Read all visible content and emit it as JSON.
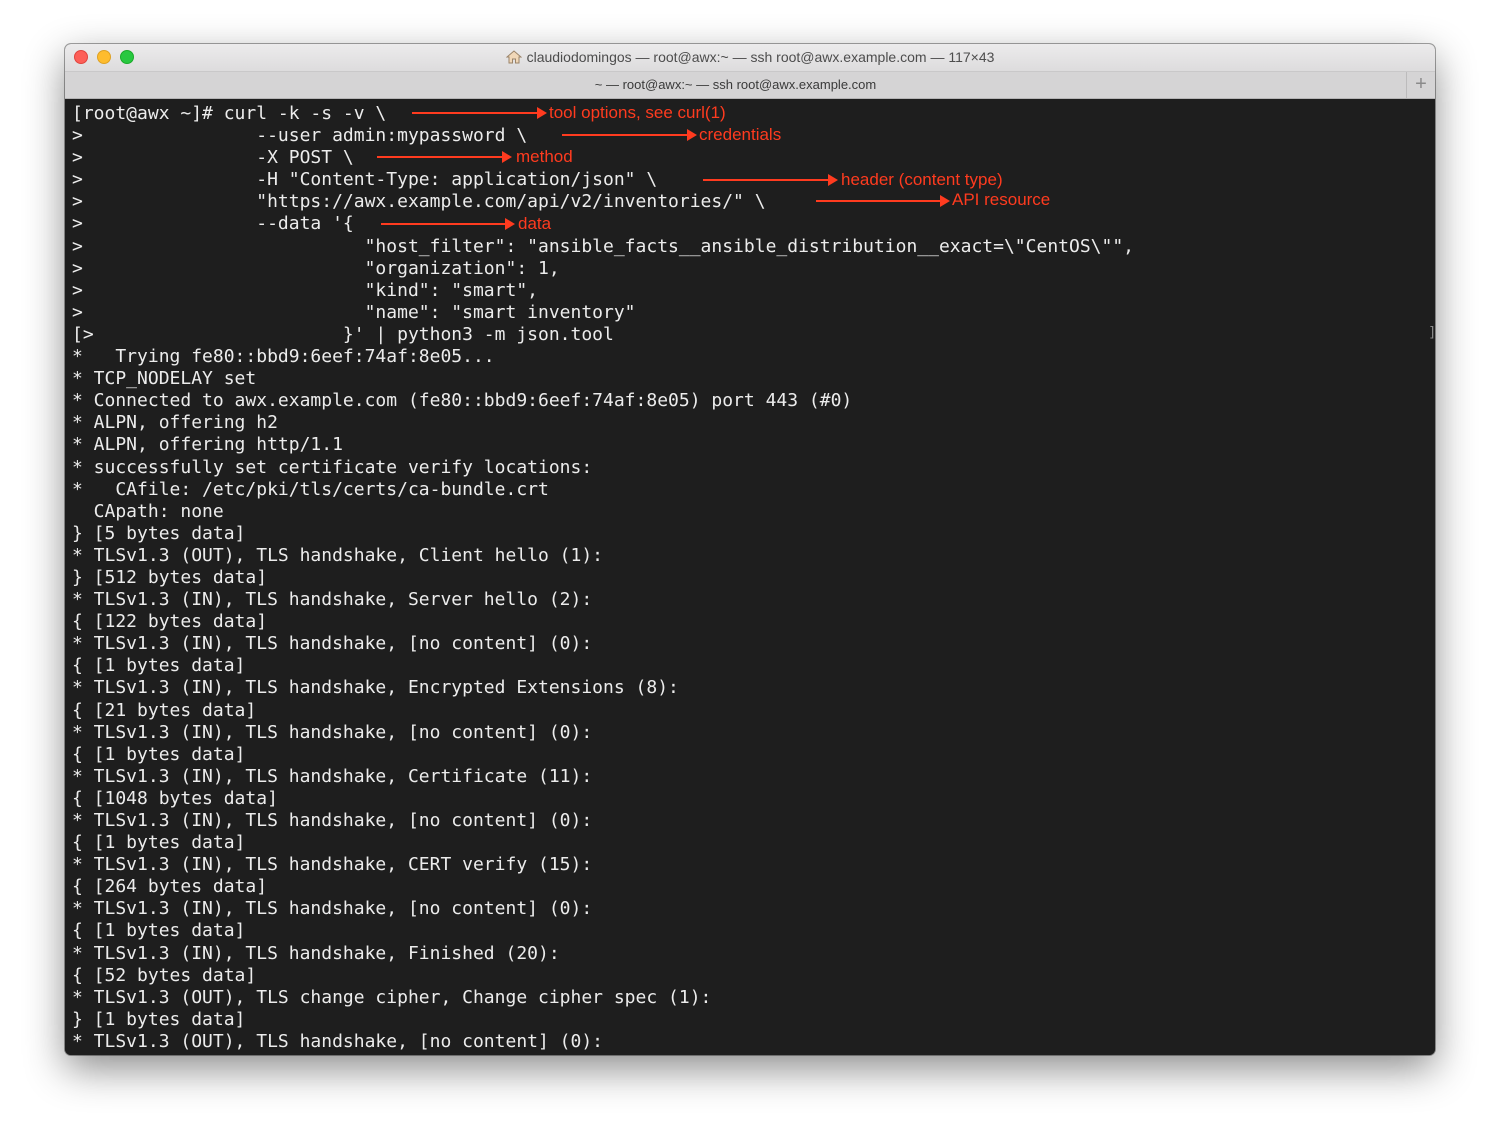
{
  "window": {
    "title": "claudiodomingos — root@awx:~ — ssh root@awx.example.com — 117×43",
    "tab_label": "~ — root@awx:~ — ssh root@awx.example.com",
    "new_tab_label": "+"
  },
  "terminal": {
    "lines": [
      "[root@awx ~]# curl -k -s -v \\",
      ">                --user admin:mypassword \\",
      ">                -X POST \\",
      ">                -H \"Content-Type: application/json\" \\",
      ">                \"https://awx.example.com/api/v2/inventories/\" \\",
      ">                --data '{",
      ">                          \"host_filter\": \"ansible_facts__ansible_distribution__exact=\\\"CentOS\\\"\",",
      ">                          \"organization\": 1,",
      ">                          \"kind\": \"smart\",",
      ">                          \"name\": \"smart inventory\"",
      "[>                       }' | python3 -m json.tool",
      "*   Trying fe80::bbd9:6eef:74af:8e05...",
      "* TCP_NODELAY set",
      "* Connected to awx.example.com (fe80::bbd9:6eef:74af:8e05) port 443 (#0)",
      "* ALPN, offering h2",
      "* ALPN, offering http/1.1",
      "* successfully set certificate verify locations:",
      "*   CAfile: /etc/pki/tls/certs/ca-bundle.crt",
      "  CApath: none",
      "} [5 bytes data]",
      "* TLSv1.3 (OUT), TLS handshake, Client hello (1):",
      "} [512 bytes data]",
      "* TLSv1.3 (IN), TLS handshake, Server hello (2):",
      "{ [122 bytes data]",
      "* TLSv1.3 (IN), TLS handshake, [no content] (0):",
      "{ [1 bytes data]",
      "* TLSv1.3 (IN), TLS handshake, Encrypted Extensions (8):",
      "{ [21 bytes data]",
      "* TLSv1.3 (IN), TLS handshake, [no content] (0):",
      "{ [1 bytes data]",
      "* TLSv1.3 (IN), TLS handshake, Certificate (11):",
      "{ [1048 bytes data]",
      "* TLSv1.3 (IN), TLS handshake, [no content] (0):",
      "{ [1 bytes data]",
      "* TLSv1.3 (IN), TLS handshake, CERT verify (15):",
      "{ [264 bytes data]",
      "* TLSv1.3 (IN), TLS handshake, [no content] (0):",
      "{ [1 bytes data]",
      "* TLSv1.3 (IN), TLS handshake, Finished (20):",
      "{ [52 bytes data]",
      "* TLSv1.3 (OUT), TLS change cipher, Change cipher spec (1):",
      "} [1 bytes data]",
      "* TLSv1.3 (OUT), TLS handshake, [no content] (0):"
    ],
    "selection_marker": "]"
  },
  "annotations": {
    "tool_options": "tool options, see curl(1)",
    "credentials": "credentials",
    "method": "method",
    "header": "header (content type)",
    "api_resource": "API resource",
    "data": "data"
  },
  "colors": {
    "annotation": "#ff3b1f",
    "terminal_bg": "#1e1e1e",
    "terminal_fg": "#ececec"
  }
}
